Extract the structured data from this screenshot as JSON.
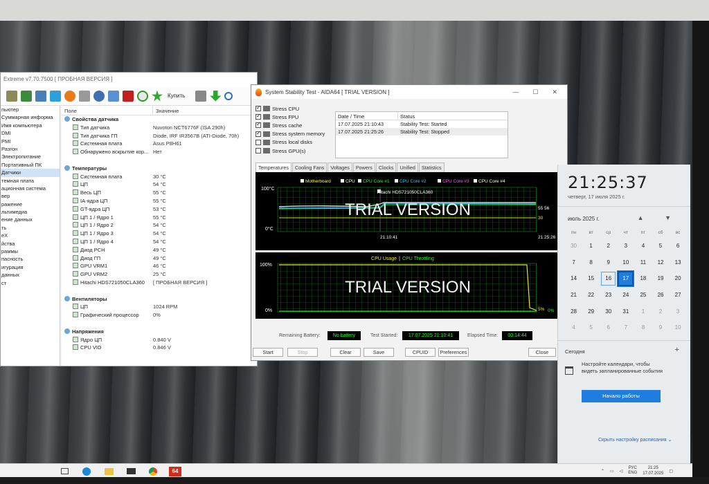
{
  "main_window": {
    "title": "Extreme v7.70.7500 [ ПРОБНАЯ ВЕРСИЯ ]",
    "buy_label": "Купить",
    "tree": [
      "пьютер",
      "Суммарная информа",
      "Имя компьютера",
      "DMI",
      "PMI",
      "Разгон",
      "Электропитание",
      "Портативный ПК",
      "Датчики",
      "темная плата",
      "ационная система",
      "вер",
      "ражение",
      "льтимедиа",
      "ение данных",
      "ть",
      "eX",
      "йства",
      "раммы",
      "пасность",
      "игурация",
      "данных",
      "ст"
    ],
    "tree_selected": 8,
    "columns": {
      "field": "Поле",
      "value": "Значение"
    },
    "rows": [
      {
        "g": true,
        "f": "Свойства датчика"
      },
      {
        "f": "Тип датчика",
        "v": "Nuvoton NCT6776F  (ISA 290h)"
      },
      {
        "f": "Тип датчика ГП",
        "v": "Diode, IRF IR3567B  (ATI-Diode, 70h)"
      },
      {
        "f": "Системная плата",
        "v": "Asus P8H61"
      },
      {
        "f": "Обнаружено вскрытие кор...",
        "v": "Нет"
      },
      {
        "f": "",
        "v": ""
      },
      {
        "g": true,
        "f": "Температуры"
      },
      {
        "f": "Системная плата",
        "v": "30 °C"
      },
      {
        "f": "ЦП",
        "v": "54 °C"
      },
      {
        "f": "Весь ЦП",
        "v": "55 °C"
      },
      {
        "f": "IA-ядра ЦП",
        "v": "55 °C"
      },
      {
        "f": "GT-ядра ЦП",
        "v": "53 °C"
      },
      {
        "f": "ЦП 1 / Ядро 1",
        "v": "55 °C"
      },
      {
        "f": "ЦП 1 / Ядро 2",
        "v": "54 °C"
      },
      {
        "f": "ЦП 1 / Ядро 3",
        "v": "54 °C"
      },
      {
        "f": "ЦП 1 / Ядро 4",
        "v": "54 °C"
      },
      {
        "f": "Диод PCH",
        "v": "49 °C"
      },
      {
        "f": "Диод ГП",
        "v": "49 °C"
      },
      {
        "f": "GPU VRM1",
        "v": "46 °C"
      },
      {
        "f": "GPU VRM2",
        "v": "25 °C"
      },
      {
        "f": "Hitachi HDS721050CLA360",
        "v": "[ ПРОБНАЯ ВЕРСИЯ ]"
      },
      {
        "f": "",
        "v": ""
      },
      {
        "g": true,
        "f": "Вентиляторы"
      },
      {
        "f": "ЦП",
        "v": "1024 RPM"
      },
      {
        "f": "Графический процессор",
        "v": "0%"
      },
      {
        "f": "",
        "v": ""
      },
      {
        "g": true,
        "f": "Напряжения"
      },
      {
        "f": "Ядро ЦП",
        "v": "0.840 V"
      },
      {
        "f": "CPU VID",
        "v": "0.846 V"
      }
    ]
  },
  "stability": {
    "title": "System Stability Test - AIDA64  [ TRIAL VERSION ]",
    "window_controls": [
      "—",
      "☐",
      "✕"
    ],
    "stress": [
      {
        "label": "Stress CPU",
        "checked": true
      },
      {
        "label": "Stress FPU",
        "checked": true
      },
      {
        "label": "Stress cache",
        "checked": true
      },
      {
        "label": "Stress system memory",
        "checked": true
      },
      {
        "label": "Stress local disks",
        "checked": false
      },
      {
        "label": "Stress GPU(s)",
        "checked": false
      }
    ],
    "log_headers": {
      "date": "Date / Time",
      "status": "Status"
    },
    "log": [
      {
        "date": "17.07.2025 21:10:43",
        "status": "Stability Test: Started"
      },
      {
        "date": "17.07.2025 21:25:26",
        "status": "Stability Test: Stopped"
      }
    ],
    "tabs": [
      "Temperatures",
      "Cooling Fans",
      "Voltages",
      "Powers",
      "Clocks",
      "Unified",
      "Statistics"
    ],
    "graph1": {
      "legend": [
        "Motherboard",
        "CPU",
        "CPU Core #1",
        "CPU Core #2",
        "CPU Core #3",
        "CPU Core #4"
      ],
      "legend_colors": [
        "#ffff33",
        "#ffffff",
        "#2ef52e",
        "#33ccff",
        "#ff55ff",
        "#ffffff"
      ],
      "legend2": "Hitachi HDS721050CLA360",
      "y_top": "100°C",
      "y_bottom": "0°C",
      "x_start": "21:10:41",
      "x_end": "21:25:26",
      "watermark": "TRIAL VERSION",
      "end_values": [
        "55 56",
        "30"
      ]
    },
    "graph2": {
      "legend_a": "CPU Usage",
      "legend_sep": "|",
      "legend_b": "CPU Throttling",
      "y_top": "100%",
      "y_bottom": "0%",
      "watermark": "TRIAL VERSION",
      "end_values": [
        "5%",
        "0%"
      ]
    },
    "stats": {
      "battery_label": "Remaining Battery:",
      "battery": "No battery",
      "started_label": "Test Started:",
      "started": "17.07.2025 21:10:41",
      "elapsed_label": "Elapsed Time:",
      "elapsed": "00:14:44"
    },
    "buttons": {
      "start": "Start",
      "stop": "Stop",
      "clear": "Clear",
      "save": "Save",
      "cpuid": "CPUID",
      "preferences": "Preferences",
      "close": "Close"
    }
  },
  "calendar": {
    "time": "21:25:37",
    "date": "четверг, 17 июля 2025 г.",
    "month": "июль 2025 г.",
    "arrows": "▲ ▼",
    "weekdays": [
      "пн",
      "вт",
      "ср",
      "чт",
      "пт",
      "сб",
      "вс"
    ],
    "weeks": [
      [
        "30",
        "1",
        "2",
        "3",
        "4",
        "5",
        "6"
      ],
      [
        "7",
        "8",
        "9",
        "10",
        "11",
        "12",
        "13"
      ],
      [
        "14",
        "15",
        "16",
        "17",
        "18",
        "19",
        "20"
      ],
      [
        "21",
        "22",
        "23",
        "24",
        "25",
        "26",
        "27"
      ],
      [
        "28",
        "29",
        "30",
        "31",
        "1",
        "2",
        "3"
      ],
      [
        "4",
        "5",
        "6",
        "7",
        "8",
        "9",
        "10"
      ]
    ],
    "today": "Сегодня",
    "plus": "+",
    "setup_text": "Настройте календари, чтобы видеть запланированные события",
    "start_button": "Начало работы",
    "hide_schedule": "Скрыть настройку расписания ⌄"
  },
  "taskbar": {
    "lang": "РУС",
    "lang2": "ENG",
    "time": "21:25",
    "date": "17.07.2025",
    "aida_label": "64"
  }
}
